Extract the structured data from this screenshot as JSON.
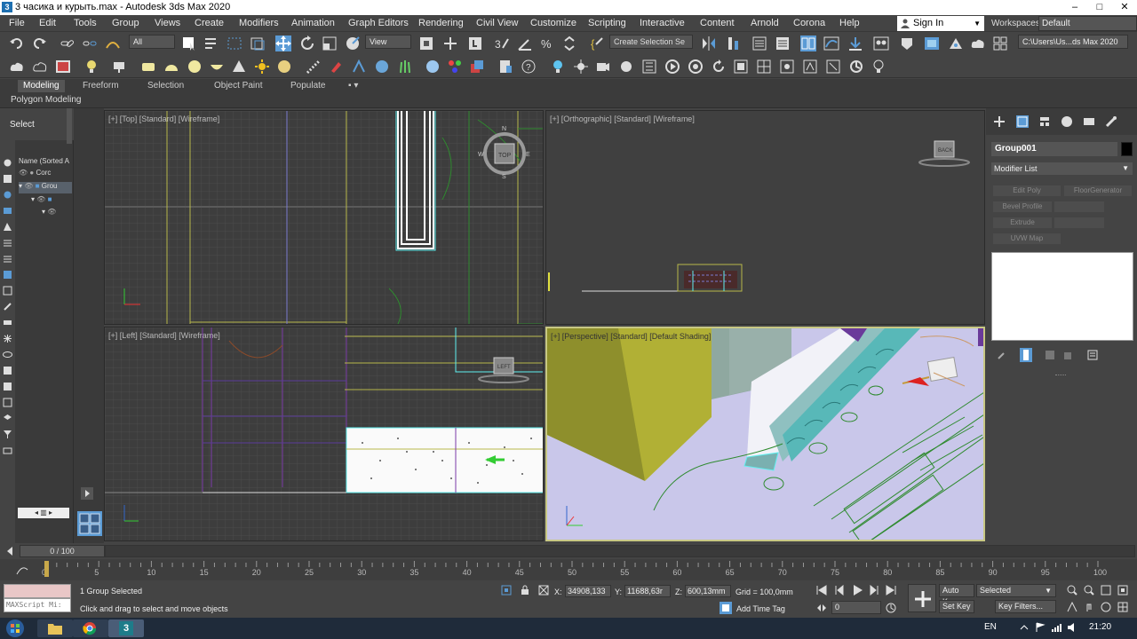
{
  "window": {
    "title": "3 часика и  курыть.max - Autodesk 3ds Max 2020",
    "icon_text": "3"
  },
  "menu": [
    "File",
    "Edit",
    "Tools",
    "Group",
    "Views",
    "Create",
    "Modifiers",
    "Animation",
    "Graph Editors",
    "Rendering",
    "Civil View",
    "Customize",
    "Scripting",
    "Interactive",
    "Content",
    "Arnold",
    "Corona",
    "Help"
  ],
  "signin": {
    "label": "Sign In"
  },
  "workspace": {
    "label": "Workspaces:",
    "value": "Default"
  },
  "toolbar": {
    "filter_value": "All",
    "ref_coord_value": "View",
    "selection_set_placeholder": "Create Selection Se",
    "path_value": "C:\\Users\\Us...ds Max 2020"
  },
  "ribbon": {
    "tabs": [
      "Modeling",
      "Freeform",
      "Selection",
      "Object Paint",
      "Populate"
    ],
    "active": "Modeling",
    "subtitle": "Polygon Modeling"
  },
  "scene_explorer": {
    "select_label": "Select",
    "name_header": "Name (Sorted A",
    "rows": [
      {
        "label": "Corc",
        "selected": false
      },
      {
        "label": "Grou",
        "selected": true
      },
      {
        "label": "",
        "selected": false
      },
      {
        "label": "",
        "selected": false
      }
    ]
  },
  "viewports": {
    "top_label": "[+] [Top] [Standard] [Wireframe]",
    "ortho_label": "[+] [Orthographic] [Standard] [Wireframe]",
    "left_label": "[+] [Left] [Standard] [Wireframe]",
    "persp_label": "[+] [Perspective] [Standard] [Default Shading]",
    "viewcube_top": "TOP",
    "viewcube_back": "BACK",
    "viewcube_left": "LEFT",
    "compass": [
      "N",
      "E",
      "S",
      "W"
    ]
  },
  "command_panel": {
    "object_name": "Group001",
    "modifier_list": "Modifier List",
    "buttons": [
      "Edit Poly",
      "FloorGenerator",
      "Bevel Profile",
      "",
      "Extrude",
      "",
      "UVW Map"
    ]
  },
  "timeline": {
    "slider": "0 / 100",
    "ticks": [
      "0",
      "5",
      "10",
      "15",
      "20",
      "25",
      "30",
      "35",
      "40",
      "45",
      "50",
      "55",
      "60",
      "65",
      "70",
      "75",
      "80",
      "85",
      "90",
      "95",
      "100"
    ]
  },
  "status": {
    "maxscript_placeholder": "MAXScript Mi:",
    "selected_text": "1 Group Selected",
    "prompt_text": "Click and drag to select and move objects",
    "x_label": "X:",
    "x_value": "34908,133",
    "y_label": "Y:",
    "y_value": "11688,63r",
    "z_label": "Z:",
    "z_value": "600,13mm",
    "grid": "Grid = 100,0mm",
    "add_time_tag": "Add Time Tag",
    "auto_key": "Auto Key",
    "set_key": "Set Key",
    "selected_dropdown": "Selected",
    "key_filters": "Key Filters...",
    "frame_value": "0"
  },
  "taskbar": {
    "lang": "EN",
    "time": "21:20"
  },
  "colors": {
    "accent_blue": "#5b9bd5",
    "viewport_bg": "#3d3d3d",
    "persp_floor": "#c9c7ea",
    "persp_box": "#a9a52f",
    "active_border": "#c8c884"
  }
}
